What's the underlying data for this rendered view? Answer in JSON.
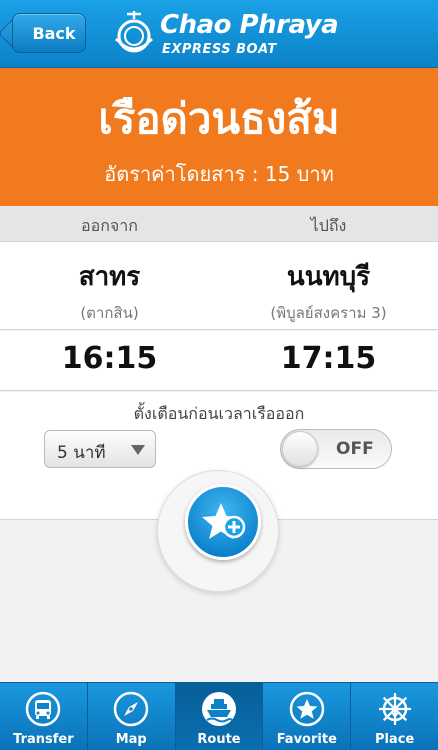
{
  "header": {
    "back_label": "Back",
    "brand_title": "Chao Phraya",
    "brand_subtitle": "EXPRESS BOAT",
    "colors": {
      "bar": "#0c82c9"
    }
  },
  "banner": {
    "title": "เรือด่วนธงส้ม",
    "fare": "อัตราค่าโดยสาร : 15 บาท",
    "color": "#f27a1e"
  },
  "route": {
    "from_label": "ออกจาก",
    "to_label": "ไปถึง",
    "from_station": "สาทร",
    "from_sub": "(ตากสิน)",
    "to_station": "นนทบุรี",
    "to_sub": "(พิบูลย์สงคราม 3)",
    "depart_time": "16:15",
    "arrive_time": "17:15"
  },
  "alarm": {
    "label": "ตั้งเตือนก่อนเวลาเรือออก",
    "minutes_value": "5 นาที",
    "toggle_label": "OFF"
  },
  "fab": {
    "icon": "star-plus-icon"
  },
  "tabs": [
    {
      "label": "Transfer",
      "icon": "bus-icon"
    },
    {
      "label": "Map",
      "icon": "compass-icon"
    },
    {
      "label": "Route",
      "icon": "boat-icon",
      "active": true
    },
    {
      "label": "Favorite",
      "icon": "star-icon"
    },
    {
      "label": "Place",
      "icon": "ship-wheel-icon"
    }
  ]
}
